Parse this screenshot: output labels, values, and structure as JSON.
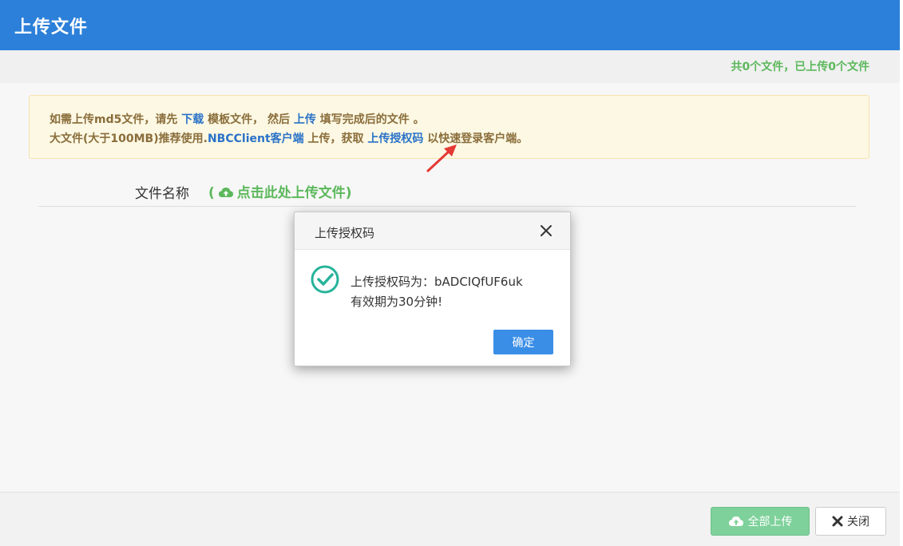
{
  "header": {
    "title": "上传文件"
  },
  "stats": {
    "text": "共0个文件，已上传0个文件"
  },
  "notice": {
    "line1_a": "如需上传md5文件，请先 ",
    "download_link": "下载",
    "line1_b": " 模板文件， 然后 ",
    "upload_link": "上传",
    "line1_c": " 填写完成后的文件 。",
    "line2_a": "大文件(大于100MB)推荐使用.",
    "client_link": "NBCClient客户端",
    "line2_b": " 上传，获取 ",
    "auth_link": "上传授权码",
    "line2_c": " 以快速登录客户端。"
  },
  "file_table": {
    "column_label": "文件名称",
    "upload_prefix": "(",
    "upload_label": "点击此处上传文件",
    "upload_suffix": ")"
  },
  "footer": {
    "upload_all_label": "全部上传",
    "close_label": "关闭"
  },
  "modal": {
    "title": "上传授权码",
    "message_line1": "上传授权码为：bADCIQfUF6uk",
    "message_line2": "有效期为30分钟!",
    "ok_label": "确定"
  },
  "colors": {
    "header_bg": "#2c80d9",
    "success_green": "#5cb85c",
    "link_blue": "#2a72c8",
    "notice_bg": "#fcf8e3",
    "ok_button": "#3a8ee6",
    "annotation_arrow": "#e53935"
  }
}
